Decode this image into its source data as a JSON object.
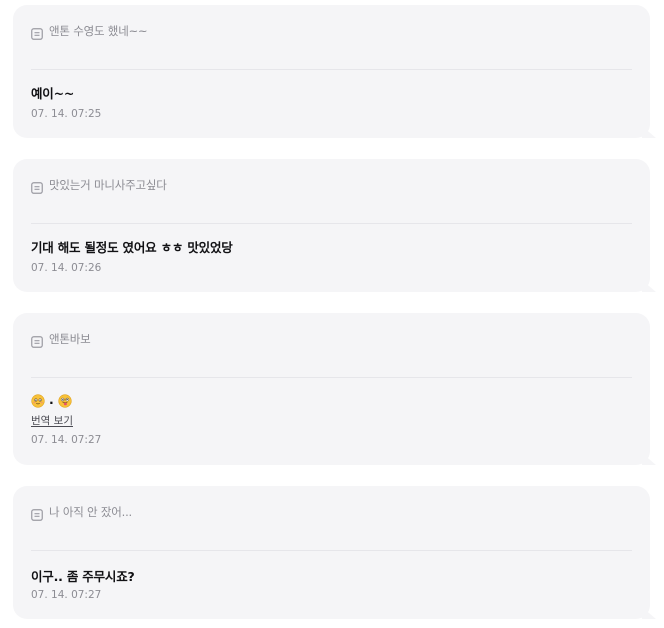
{
  "messages": [
    {
      "quote": "앤톤 수영도 했네~~",
      "reply": "예이~~",
      "time": "07. 14. 07:25"
    },
    {
      "quote": "맛있는거 마니사주고싶다",
      "reply": "기대 해도 될정도 였어요 ㅎㅎ 맛있었당",
      "time": "07. 14. 07:26"
    },
    {
      "quote": "앤톤바보",
      "reply_emojis": [
        "smiling-face-emoji",
        "tongue-face-emoji"
      ],
      "reply_separator": ".",
      "translate_link": "번역 보기",
      "time": "07. 14. 07:27"
    },
    {
      "quote": "나 아직 안 잤어...",
      "reply": "이구.. 좀 주무시죠?",
      "time": "07. 14. 07:27"
    }
  ],
  "colors": {
    "card_background": "#f5f5f7",
    "quote_text": "#8c8c93",
    "reply_text": "#111114",
    "divider": "#e6e6ea"
  }
}
